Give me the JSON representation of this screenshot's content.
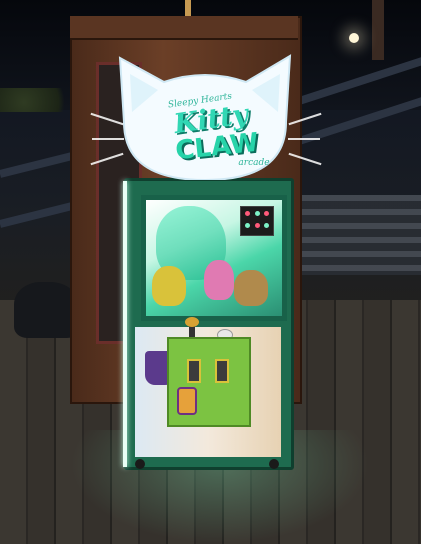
{
  "scene": {
    "description_visible_text": false
  },
  "sign": {
    "tagline": "Sleepy Hearts",
    "title_line1": "Kitty",
    "title_line2": "CLAW",
    "subtitle": "arcade"
  },
  "colors": {
    "cabinet_green": "#1e6b4f",
    "title_teal": "#31d7b4",
    "control_panel": "#7cc342",
    "wood": "#6b3f27"
  }
}
